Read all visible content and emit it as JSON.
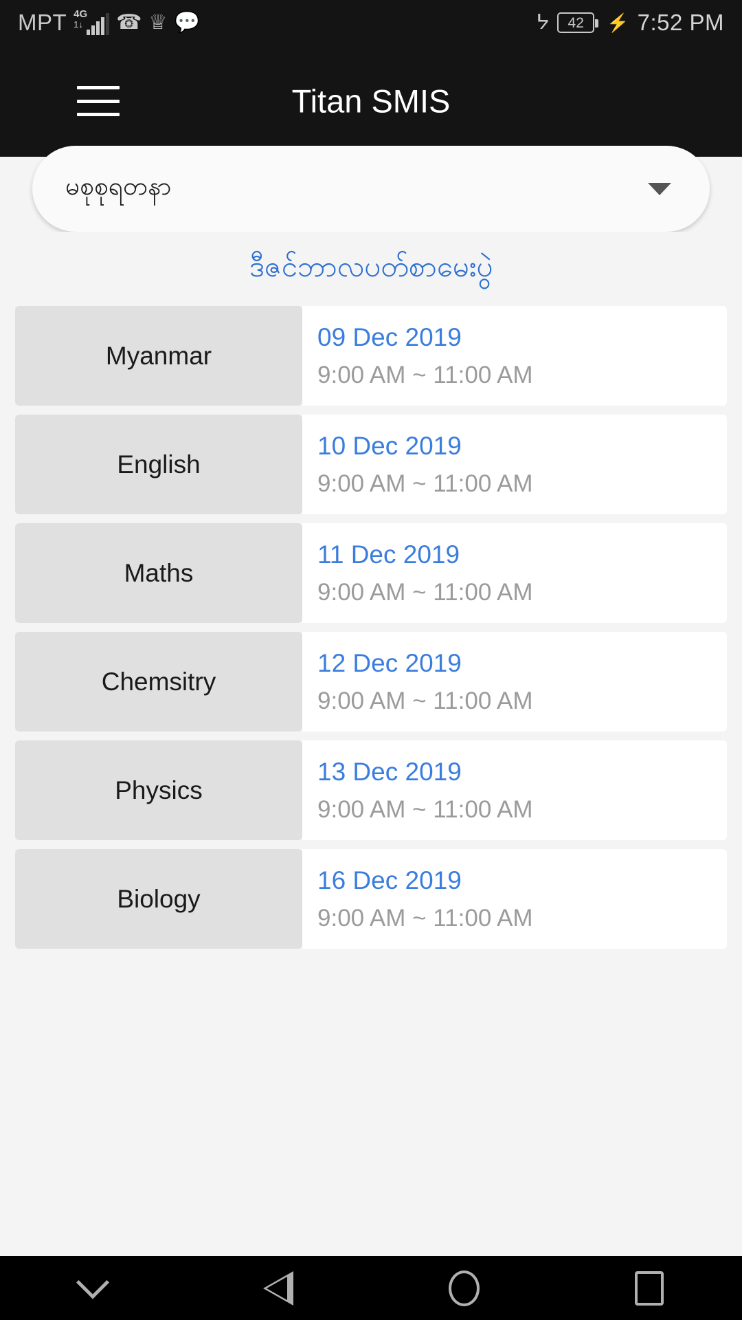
{
  "status_bar": {
    "carrier": "MPT",
    "network_type": "4G",
    "network_sub": "1↓",
    "signal_bars": 4,
    "signal_bars_total": 5,
    "icons": [
      "call-icon",
      "usb-icon",
      "message-icon",
      "bluetooth-icon"
    ],
    "battery_level": "42",
    "charging": true,
    "time": "7:52 PM"
  },
  "app_bar": {
    "menu_icon": "hamburger-menu-icon",
    "title": "Titan SMIS"
  },
  "student_selector": {
    "selected": "မစုစုရတနာ",
    "caret_icon": "chevron-down-icon"
  },
  "exam": {
    "heading": "ဒီဇင်ဘာလပတ်စာမေးပွဲ",
    "heading_color": "#3b7ddd",
    "rows": [
      {
        "subject": "Myanmar",
        "date": "09 Dec 2019",
        "time": "9:00 AM ~ 11:00 AM"
      },
      {
        "subject": "English",
        "date": "10 Dec 2019",
        "time": "9:00 AM ~ 11:00 AM"
      },
      {
        "subject": "Maths",
        "date": "11 Dec 2019",
        "time": "9:00 AM ~ 11:00 AM"
      },
      {
        "subject": "Chemsitry",
        "date": "12 Dec 2019",
        "time": "9:00 AM ~ 11:00 AM"
      },
      {
        "subject": "Physics",
        "date": "13 Dec 2019",
        "time": "9:00 AM ~ 11:00 AM"
      },
      {
        "subject": "Biology",
        "date": "16 Dec 2019",
        "time": "9:00 AM ~ 11:00 AM"
      }
    ]
  },
  "nav_bar": {
    "buttons": [
      "hide-keyboard-chevron-icon",
      "back-triangle-icon",
      "home-circle-icon",
      "recents-square-icon"
    ]
  }
}
